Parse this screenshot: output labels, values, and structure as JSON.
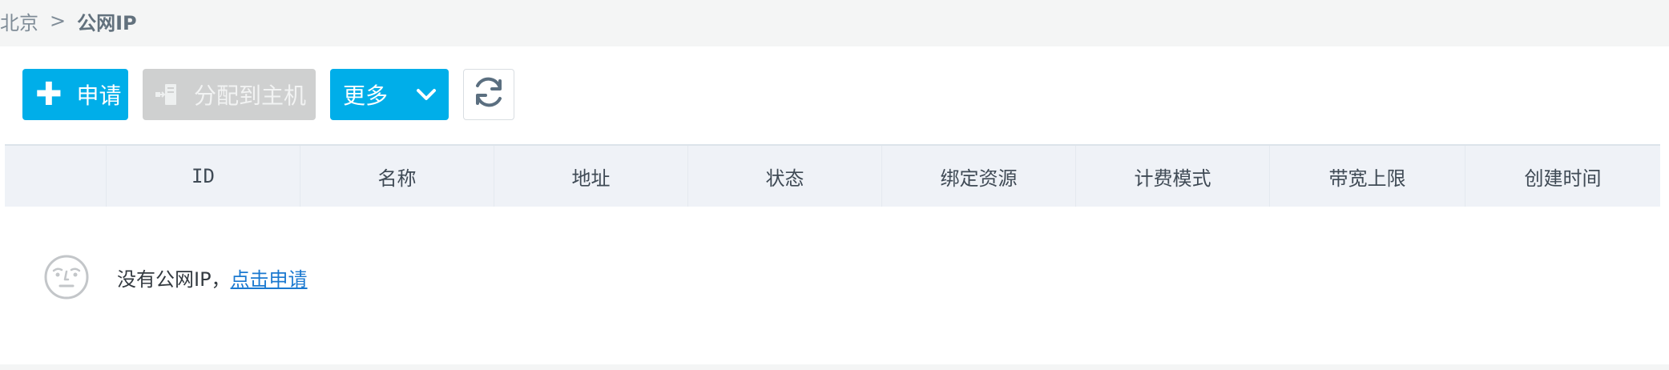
{
  "breadcrumb": {
    "region": "北京",
    "separator": ">",
    "current": "公网IP"
  },
  "toolbar": {
    "apply_label": "申请",
    "assign_label": "分配到主机",
    "more_label": "更多"
  },
  "table": {
    "columns": [
      "",
      "ID",
      "名称",
      "地址",
      "状态",
      "绑定资源",
      "计费模式",
      "带宽上限",
      "创建时间"
    ]
  },
  "empty_state": {
    "message": "没有公网IP，",
    "link_text": "点击申请"
  },
  "colors": {
    "primary": "#00aee9",
    "disabled": "#cfd0d0",
    "link": "#1b79d0",
    "header_bg": "#eff2f7"
  },
  "icons": [
    "plus-icon",
    "assign-host-icon",
    "chevron-down-icon",
    "refresh-icon",
    "sad-face-icon"
  ]
}
